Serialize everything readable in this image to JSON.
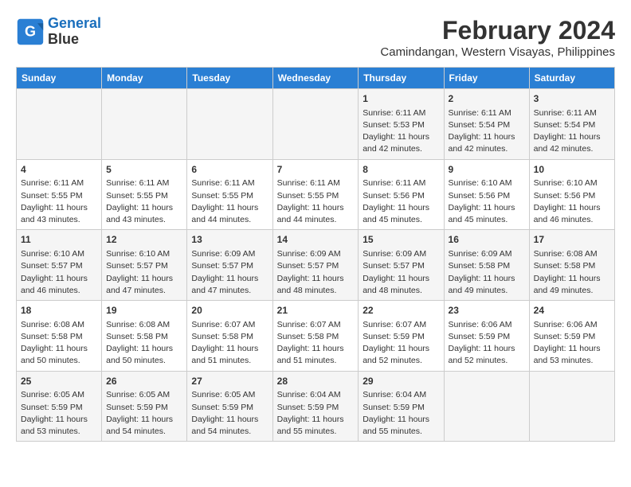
{
  "header": {
    "logo_line1": "General",
    "logo_line2": "Blue",
    "month_year": "February 2024",
    "location": "Camindangan, Western Visayas, Philippines"
  },
  "days_of_week": [
    "Sunday",
    "Monday",
    "Tuesday",
    "Wednesday",
    "Thursday",
    "Friday",
    "Saturday"
  ],
  "weeks": [
    [
      {
        "day": "",
        "info": ""
      },
      {
        "day": "",
        "info": ""
      },
      {
        "day": "",
        "info": ""
      },
      {
        "day": "",
        "info": ""
      },
      {
        "day": "1",
        "info": "Sunrise: 6:11 AM\nSunset: 5:53 PM\nDaylight: 11 hours\nand 42 minutes."
      },
      {
        "day": "2",
        "info": "Sunrise: 6:11 AM\nSunset: 5:54 PM\nDaylight: 11 hours\nand 42 minutes."
      },
      {
        "day": "3",
        "info": "Sunrise: 6:11 AM\nSunset: 5:54 PM\nDaylight: 11 hours\nand 42 minutes."
      }
    ],
    [
      {
        "day": "4",
        "info": "Sunrise: 6:11 AM\nSunset: 5:55 PM\nDaylight: 11 hours\nand 43 minutes."
      },
      {
        "day": "5",
        "info": "Sunrise: 6:11 AM\nSunset: 5:55 PM\nDaylight: 11 hours\nand 43 minutes."
      },
      {
        "day": "6",
        "info": "Sunrise: 6:11 AM\nSunset: 5:55 PM\nDaylight: 11 hours\nand 44 minutes."
      },
      {
        "day": "7",
        "info": "Sunrise: 6:11 AM\nSunset: 5:55 PM\nDaylight: 11 hours\nand 44 minutes."
      },
      {
        "day": "8",
        "info": "Sunrise: 6:11 AM\nSunset: 5:56 PM\nDaylight: 11 hours\nand 45 minutes."
      },
      {
        "day": "9",
        "info": "Sunrise: 6:10 AM\nSunset: 5:56 PM\nDaylight: 11 hours\nand 45 minutes."
      },
      {
        "day": "10",
        "info": "Sunrise: 6:10 AM\nSunset: 5:56 PM\nDaylight: 11 hours\nand 46 minutes."
      }
    ],
    [
      {
        "day": "11",
        "info": "Sunrise: 6:10 AM\nSunset: 5:57 PM\nDaylight: 11 hours\nand 46 minutes."
      },
      {
        "day": "12",
        "info": "Sunrise: 6:10 AM\nSunset: 5:57 PM\nDaylight: 11 hours\nand 47 minutes."
      },
      {
        "day": "13",
        "info": "Sunrise: 6:09 AM\nSunset: 5:57 PM\nDaylight: 11 hours\nand 47 minutes."
      },
      {
        "day": "14",
        "info": "Sunrise: 6:09 AM\nSunset: 5:57 PM\nDaylight: 11 hours\nand 48 minutes."
      },
      {
        "day": "15",
        "info": "Sunrise: 6:09 AM\nSunset: 5:57 PM\nDaylight: 11 hours\nand 48 minutes."
      },
      {
        "day": "16",
        "info": "Sunrise: 6:09 AM\nSunset: 5:58 PM\nDaylight: 11 hours\nand 49 minutes."
      },
      {
        "day": "17",
        "info": "Sunrise: 6:08 AM\nSunset: 5:58 PM\nDaylight: 11 hours\nand 49 minutes."
      }
    ],
    [
      {
        "day": "18",
        "info": "Sunrise: 6:08 AM\nSunset: 5:58 PM\nDaylight: 11 hours\nand 50 minutes."
      },
      {
        "day": "19",
        "info": "Sunrise: 6:08 AM\nSunset: 5:58 PM\nDaylight: 11 hours\nand 50 minutes."
      },
      {
        "day": "20",
        "info": "Sunrise: 6:07 AM\nSunset: 5:58 PM\nDaylight: 11 hours\nand 51 minutes."
      },
      {
        "day": "21",
        "info": "Sunrise: 6:07 AM\nSunset: 5:58 PM\nDaylight: 11 hours\nand 51 minutes."
      },
      {
        "day": "22",
        "info": "Sunrise: 6:07 AM\nSunset: 5:59 PM\nDaylight: 11 hours\nand 52 minutes."
      },
      {
        "day": "23",
        "info": "Sunrise: 6:06 AM\nSunset: 5:59 PM\nDaylight: 11 hours\nand 52 minutes."
      },
      {
        "day": "24",
        "info": "Sunrise: 6:06 AM\nSunset: 5:59 PM\nDaylight: 11 hours\nand 53 minutes."
      }
    ],
    [
      {
        "day": "25",
        "info": "Sunrise: 6:05 AM\nSunset: 5:59 PM\nDaylight: 11 hours\nand 53 minutes."
      },
      {
        "day": "26",
        "info": "Sunrise: 6:05 AM\nSunset: 5:59 PM\nDaylight: 11 hours\nand 54 minutes."
      },
      {
        "day": "27",
        "info": "Sunrise: 6:05 AM\nSunset: 5:59 PM\nDaylight: 11 hours\nand 54 minutes."
      },
      {
        "day": "28",
        "info": "Sunrise: 6:04 AM\nSunset: 5:59 PM\nDaylight: 11 hours\nand 55 minutes."
      },
      {
        "day": "29",
        "info": "Sunrise: 6:04 AM\nSunset: 5:59 PM\nDaylight: 11 hours\nand 55 minutes."
      },
      {
        "day": "",
        "info": ""
      },
      {
        "day": "",
        "info": ""
      }
    ]
  ]
}
